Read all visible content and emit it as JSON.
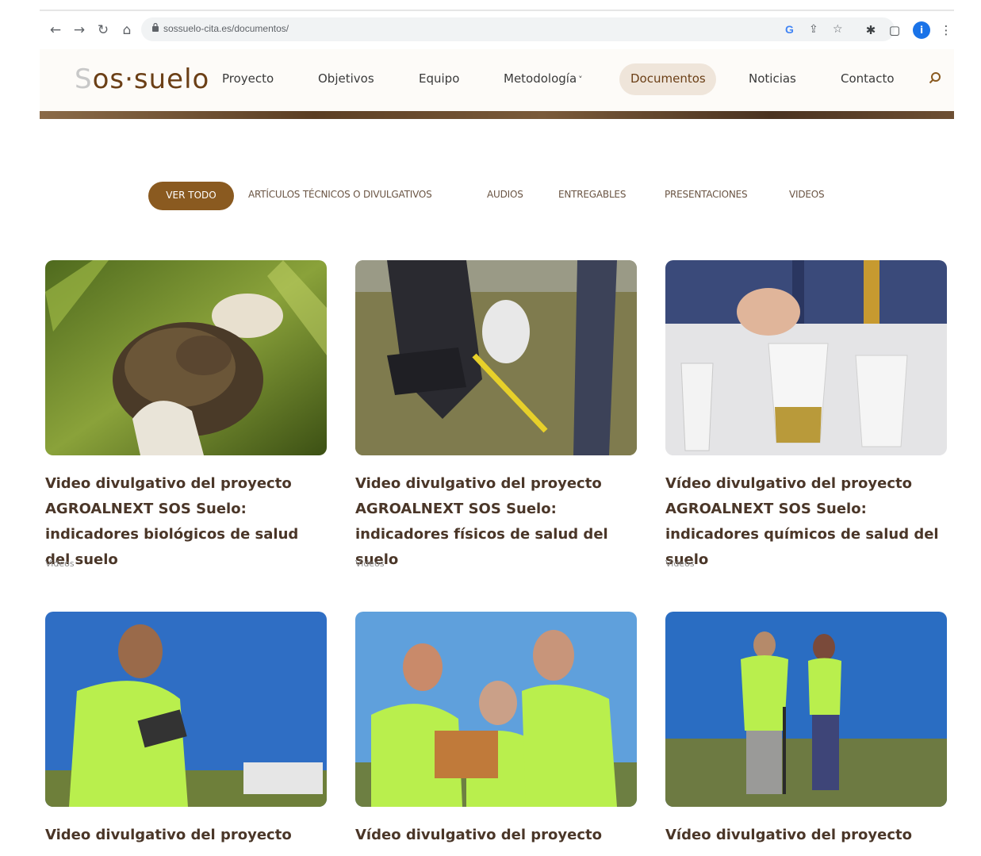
{
  "browser": {
    "url": "sossuelo-cita.es/documentos/",
    "profile_initial": "i",
    "google_label": "G"
  },
  "site": {
    "logo_prefix": "S",
    "logo_rest": "os·suelo",
    "menu": [
      {
        "label": "Proyecto"
      },
      {
        "label": "Objetivos"
      },
      {
        "label": "Equipo"
      },
      {
        "label": "Metodología"
      },
      {
        "label": "Documentos"
      },
      {
        "label": "Noticias"
      },
      {
        "label": "Contacto"
      }
    ],
    "metodologia_caret": "˅"
  },
  "filters": [
    {
      "label": "VER TODO"
    },
    {
      "label": "ARTÍCULOS TÉCNICOS O DIVULGATIVOS"
    },
    {
      "label": "AUDIOS"
    },
    {
      "label": "ENTREGABLES"
    },
    {
      "label": "PRESENTACIONES"
    },
    {
      "label": "VIDEOS"
    }
  ],
  "cards": [
    {
      "title": "Video divulgativo del proyecto AGROALNEXT SOS Suelo: indicadores biológicos de salud del suelo",
      "category": "Videos"
    },
    {
      "title": "Video divulgativo del proyecto AGROALNEXT SOS Suelo: indicadores físicos de salud del suelo",
      "category": "Videos"
    },
    {
      "title": "Vídeo divulgativo del proyecto AGROALNEXT SOS Suelo: indicadores químicos de salud del suelo",
      "category": "Videos"
    },
    {
      "title": "Video divulgativo del proyecto",
      "category": ""
    },
    {
      "title": "Vídeo divulgativo del proyecto",
      "category": ""
    },
    {
      "title": "Vídeo divulgativo del proyecto",
      "category": ""
    }
  ],
  "colors": {
    "accent_brown": "#8a5a20",
    "active_menu_bg": "#efe5da",
    "title_text": "#4a3628"
  }
}
